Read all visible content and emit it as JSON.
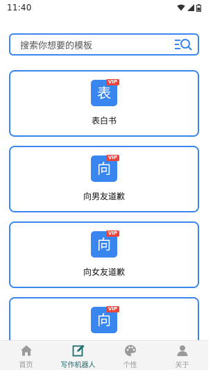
{
  "status_bar": {
    "time": "11:40"
  },
  "search": {
    "placeholder": "搜索你想要的模板"
  },
  "cards": [
    {
      "icon_char": "表",
      "badge": "VIP",
      "title": "表白书"
    },
    {
      "icon_char": "向",
      "badge": "VIP",
      "title": "向男友道歉"
    },
    {
      "icon_char": "向",
      "badge": "VIP",
      "title": "向女友道歉"
    },
    {
      "icon_char": "向",
      "badge": "VIP",
      "title": ""
    }
  ],
  "bottom_nav": {
    "items": [
      {
        "label": "首页",
        "icon": "home-icon",
        "active": false
      },
      {
        "label": "写作机器人",
        "icon": "edit-icon",
        "active": true
      },
      {
        "label": "个性",
        "icon": "palette-icon",
        "active": false
      },
      {
        "label": "关于",
        "icon": "person-icon",
        "active": false
      }
    ]
  },
  "colors": {
    "accent": "#3a86f0",
    "badge": "#e8453c",
    "active_nav": "#1f6e6e",
    "inactive_nav": "#999999"
  }
}
